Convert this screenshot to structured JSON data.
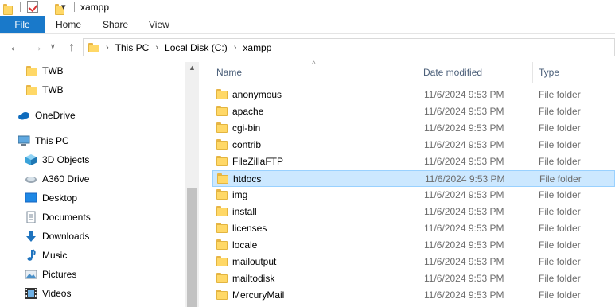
{
  "window": {
    "title": "xampp"
  },
  "ribbon": {
    "tabs": [
      "File",
      "Home",
      "Share",
      "View"
    ]
  },
  "address": {
    "crumbs": [
      "This PC",
      "Local Disk (C:)",
      "xampp"
    ]
  },
  "nav": {
    "items": [
      {
        "label": "TWB",
        "icon": "folder-icon"
      },
      {
        "label": "TWB",
        "icon": "folder-icon"
      },
      {
        "label": "OneDrive",
        "icon": "cloud-icon"
      },
      {
        "label": "This PC",
        "icon": "computer-icon"
      },
      {
        "label": "3D Objects",
        "icon": "cube-icon"
      },
      {
        "label": "A360 Drive",
        "icon": "a360-drive-icon"
      },
      {
        "label": "Desktop",
        "icon": "desktop-icon"
      },
      {
        "label": "Documents",
        "icon": "documents-icon"
      },
      {
        "label": "Downloads",
        "icon": "download-arrow-icon"
      },
      {
        "label": "Music",
        "icon": "music-note-icon"
      },
      {
        "label": "Pictures",
        "icon": "pictures-icon"
      },
      {
        "label": "Videos",
        "icon": "film-icon"
      }
    ]
  },
  "columns": {
    "name": "Name",
    "date": "Date modified",
    "type": "Type"
  },
  "files": [
    {
      "name": "anonymous",
      "date": "11/6/2024 9:53 PM",
      "type": "File folder"
    },
    {
      "name": "apache",
      "date": "11/6/2024 9:53 PM",
      "type": "File folder"
    },
    {
      "name": "cgi-bin",
      "date": "11/6/2024 9:53 PM",
      "type": "File folder"
    },
    {
      "name": "contrib",
      "date": "11/6/2024 9:53 PM",
      "type": "File folder"
    },
    {
      "name": "FileZillaFTP",
      "date": "11/6/2024 9:53 PM",
      "type": "File folder"
    },
    {
      "name": "htdocs",
      "date": "11/6/2024 9:53 PM",
      "type": "File folder",
      "selected": true
    },
    {
      "name": "img",
      "date": "11/6/2024 9:53 PM",
      "type": "File folder"
    },
    {
      "name": "install",
      "date": "11/6/2024 9:53 PM",
      "type": "File folder"
    },
    {
      "name": "licenses",
      "date": "11/6/2024 9:53 PM",
      "type": "File folder"
    },
    {
      "name": "locale",
      "date": "11/6/2024 9:53 PM",
      "type": "File folder"
    },
    {
      "name": "mailoutput",
      "date": "11/6/2024 9:53 PM",
      "type": "File folder"
    },
    {
      "name": "mailtodisk",
      "date": "11/6/2024 9:53 PM",
      "type": "File folder"
    },
    {
      "name": "MercuryMail",
      "date": "11/6/2024 9:53 PM",
      "type": "File folder"
    }
  ],
  "colors": {
    "accent": "#1979ca",
    "selection": "#cce8ff",
    "folder": "#ffd867"
  }
}
